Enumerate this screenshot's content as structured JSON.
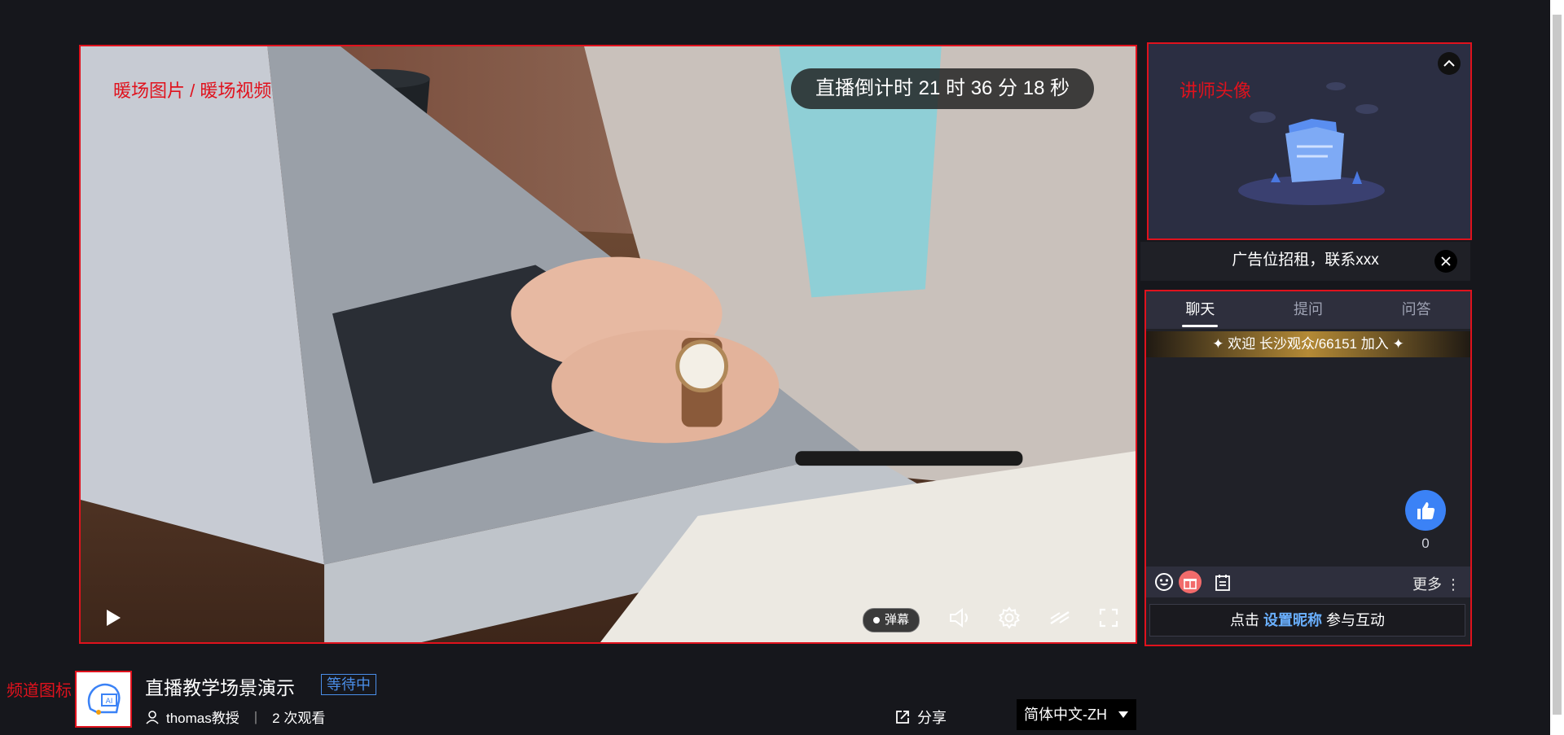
{
  "player": {
    "warmup_label": "暖场图片 /  暖场视频",
    "countdown": "直播倒计时 21 时 36 分 18 秒",
    "danmu_label": "弹幕",
    "controls": [
      "play-icon",
      "volume-icon",
      "settings-icon",
      "danmu-toggle-icon",
      "fullscreen-icon"
    ]
  },
  "teacher_panel": {
    "label": "讲师头像"
  },
  "ad": {
    "text": "广告位招租，联系xxx"
  },
  "chat": {
    "tabs": [
      "聊天",
      "提问",
      "问答"
    ],
    "active_tab": "聊天",
    "welcome": "欢迎  长沙观众/66151  加入",
    "like_count": "0",
    "more_label": "更多",
    "nick_prefix": "点击",
    "nick_link": "设置昵称",
    "nick_suffix": "参与互动"
  },
  "channel": {
    "icon_label": "频道图标",
    "title": "直播教学场景演示",
    "status": "等待中",
    "host": "thomas教授",
    "separator": "|",
    "views": "2 次观看",
    "share_label": "分享",
    "language": "简体中文-ZH"
  },
  "colors": {
    "annotation": "#e0121d",
    "accent_blue": "#3b82f6",
    "background": "#16171c"
  }
}
